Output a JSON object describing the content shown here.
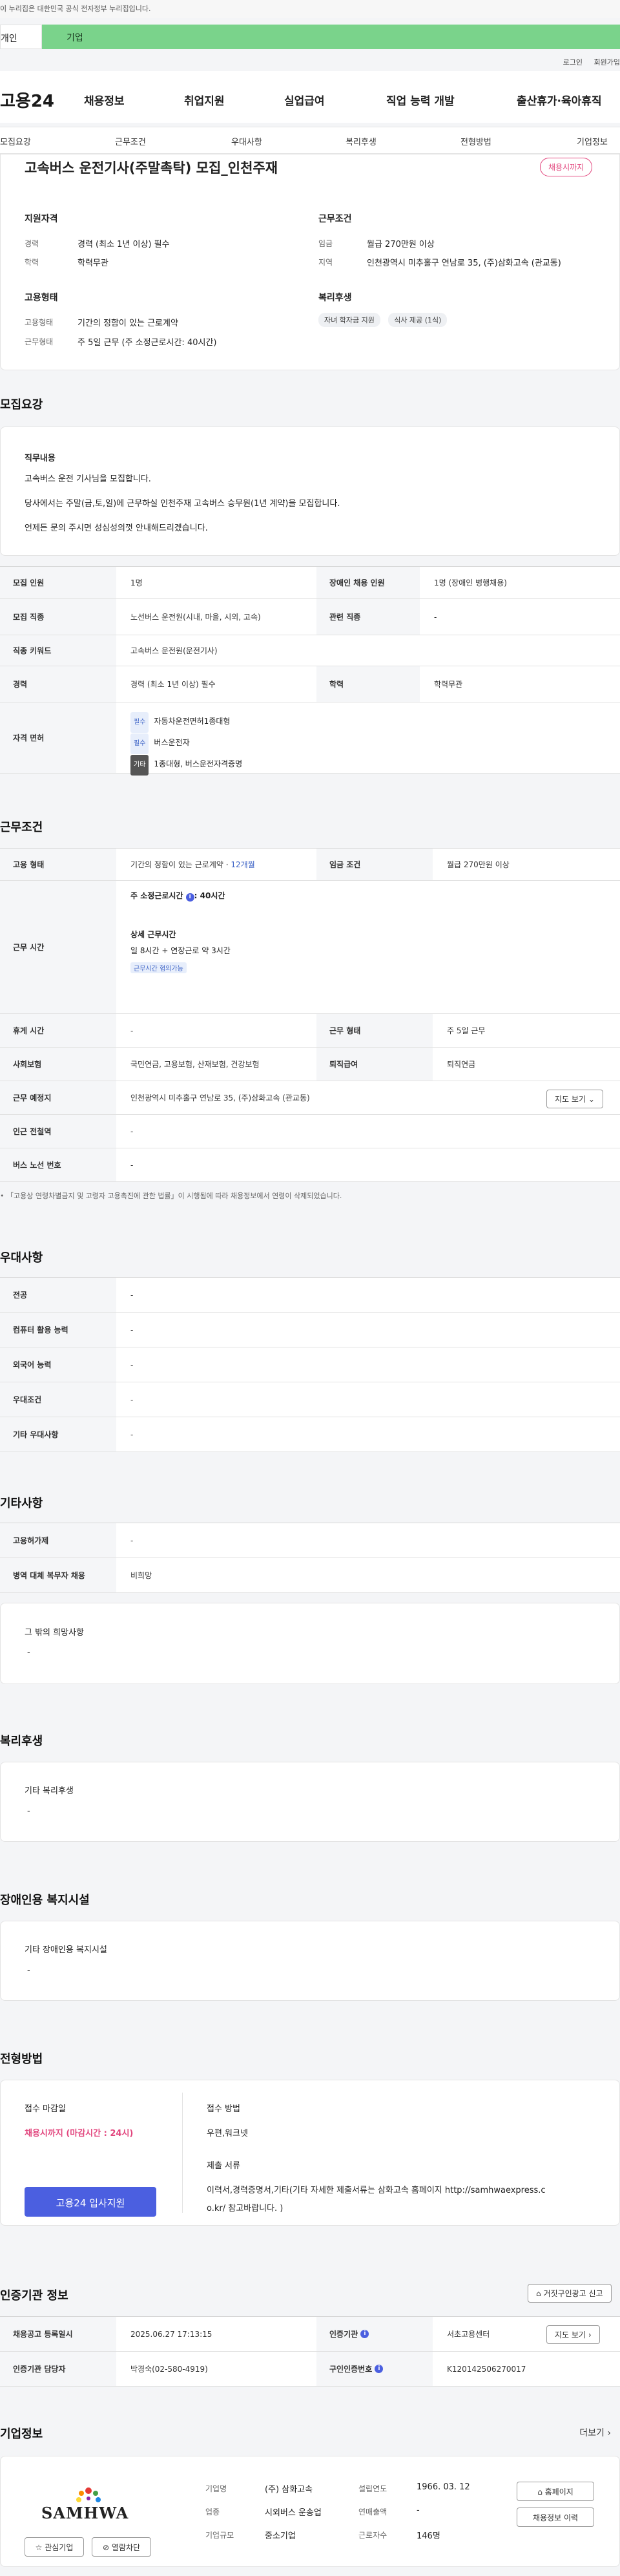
{
  "gov_banner": "이 누리집은 대한민국 공식 전자정부 누리집입니다.",
  "tabs": {
    "person": "개인",
    "company": "기업"
  },
  "util": {
    "login": "로그인",
    "join": "회원가입"
  },
  "gnb": {
    "logo": "고용24",
    "items": [
      "채용정보",
      "취업지원",
      "실업급여",
      "직업 능력 개발",
      "출산휴가·육아휴직"
    ]
  },
  "subnav": [
    "모집요강",
    "근무조건",
    "우대사항",
    "복리후생",
    "전형방법",
    "기업정보"
  ],
  "summary": {
    "title": "고속버스 운전기사(주말촉탁) 모집_인천주재",
    "status_badge": "채용시까지",
    "qual_head": "지원자격",
    "career_label": "경력",
    "career_value": "경력 (최소 1년 이상) 필수",
    "edu_label": "학력",
    "edu_value": "학력무관",
    "cond_head": "근무조건",
    "wage_label": "임금",
    "wage_value": "월급 270만원 이상",
    "region_label": "지역",
    "region_value": "인천광역시 미추홀구 연남로 35, (주)삼화고속 (관교동)",
    "emp_head": "고용형태",
    "emp_label": "고용형태",
    "emp_value": "기간의 정함이 있는 근로계약",
    "worktype_label": "근무형태",
    "worktype_value": "주 5일 근무 (주 소정근로시간: 40시간)",
    "welfare_head": "복리후생",
    "welfare_chips": [
      "자녀 학자금 지원",
      "식사 제공 (1식)"
    ]
  },
  "recruit": {
    "section_title": "모집요강",
    "duty_head": "직무내용",
    "duty_lines": [
      "고속버스 운전 기사님을 모집합니다.",
      "당사에서는 주말(금,토,일)에 근무하실 인천주재 고속버스 승무원(1년 계약)을 모집합니다.",
      "언제든 문의 주시면 성심성의껏 안내해드리겠습니다."
    ],
    "headcount_label": "모집 인원",
    "headcount_value": "1명",
    "disabled_label": "장애인 채용 인원",
    "disabled_value": "1명 (장애인 병행채용)",
    "job_label": "모집 직종",
    "job_value": "노선버스 운전원(시내, 마을, 시외, 고속)",
    "related_label": "관련 직종",
    "related_value": "-",
    "keyword_label": "직종 키워드",
    "keyword_value": "고속버스 운전원(운전기사)",
    "career_label": "경력",
    "career_value": "경력 (최소 1년 이상) 필수",
    "edu_label": "학력",
    "edu_value": "학력무관",
    "license_label": "자격 면허",
    "license_items": [
      {
        "tag": "필수",
        "text": "자동차운전면허1종대형"
      },
      {
        "tag": "필수",
        "text": "버스운전자"
      },
      {
        "tag": "기타",
        "text": "1종대형, 버스운전자격증명"
      }
    ]
  },
  "work": {
    "section_title": "근무조건",
    "emp_label": "고용 형태",
    "emp_value": "기간의 정함이 있는 근로계약 ·",
    "emp_months": "12개월",
    "wage_label": "임금 조건",
    "wage_value": "월급 270만원 이상",
    "hours_label": "근무 시간",
    "hours_line1": "주 소정근로시간",
    "hours_line1_value": ": 40시간",
    "hours_detail_head": "상세 근무시간",
    "hours_detail": "일 8시간 + 연장근로 약 3시간",
    "hours_badge": "근무시간 협의가능",
    "shift_label": "근무 형태",
    "shift_value": "주 5일 근무",
    "break_label": "휴게 시간",
    "break_value": "-",
    "insurance_label": "사회보험",
    "insurance_value": "국민연금, 고용보험, 산재보험, 건강보험",
    "retire_label": "퇴직급여",
    "retire_value": "퇴직연금",
    "place_label": "근무 예정지",
    "place_value": "인천광역시 미추홀구 연남로 35, (주)삼화고속 (관교동)",
    "map_button": "지도 보기",
    "subway_label": "인근 전철역",
    "subway_value": "-",
    "bus_label": "버스 노선 번호",
    "bus_value": "-",
    "note": "「고용상 연령차별금지 및 고령자 고용촉진에 관한 법률」이 시행됨에 따라 채용정보에서 연령이 삭제되었습니다."
  },
  "prefer": {
    "section_title": "우대사항",
    "rows": [
      {
        "label": "전공",
        "value": "-"
      },
      {
        "label": "컴퓨터 활용 능력",
        "value": "-"
      },
      {
        "label": "외국어 능력",
        "value": "-"
      },
      {
        "label": "우대조건",
        "value": "-"
      },
      {
        "label": "기타 우대사항",
        "value": "-"
      }
    ]
  },
  "etc": {
    "section_title": "기타사항",
    "disabled_label": "고용허가제",
    "disabled_value": "-",
    "military_label": "병역 대체 복무자 채용",
    "military_value": "비희망",
    "other_head": "그 밖의 희망사항",
    "other_value": "-"
  },
  "welfare": {
    "section_title": "복리후생",
    "head": "기타 복리후생",
    "value": "-"
  },
  "facility": {
    "section_title": "장애인용 복지시설",
    "head": "기타 장애인용 복지시설",
    "value": "-"
  },
  "selection": {
    "section_title": "전형방법",
    "deadline_head": "접수 마감일",
    "deadline_value": "채용시까지 (마감시간 : 24시)",
    "apply_button": "고용24 입사지원",
    "method_head": "접수 방법",
    "method_value": "우편,워크넷",
    "docs_head": "제출 서류",
    "docs_value1": "이력서,경력증명서,기타(기타 자세한 제출서류는 삼화고속 홈페이지 http://samhwaexpress.c",
    "docs_value2": "o.kr/  참고바랍니다. )"
  },
  "cert": {
    "section_title": "인증기관 정보",
    "report_button": "거짓구인광고 신고",
    "date_label": "채용공고 등록일시",
    "date_value": "2025.06.27 17:13:15",
    "org_label": "인증기관",
    "org_value": "서초고용센터",
    "map_button": "지도 보기",
    "manager_label": "인증기관 담당자",
    "manager_value": "박경숙(02-580-4919)",
    "reg_label": "구인인증번호",
    "reg_value": "K120142506270017"
  },
  "company": {
    "section_title": "기업정보",
    "more_link": "더보기",
    "logo_text": "SAMHWA",
    "name_label": "기업명",
    "name_value": "(주) 삼화고속",
    "founded_label": "설립연도",
    "founded_value": "1966. 03. 12",
    "industry_label": "업종",
    "industry_value": "시외버스 운송업",
    "sales_label": "연매출액",
    "sales_value": "-",
    "size_label": "기업규모",
    "size_value": "중소기업",
    "employees_label": "근로자수",
    "employees_value": "146명",
    "homepage_button": "홈페이지",
    "history_button": "채용정보 이력",
    "interest_button": "관심기업",
    "block_button": "열람차단"
  },
  "colors": {
    "accent_green": "#7ad38b",
    "primary_blue": "#4b5fe0",
    "status_red": "#e2457d"
  }
}
